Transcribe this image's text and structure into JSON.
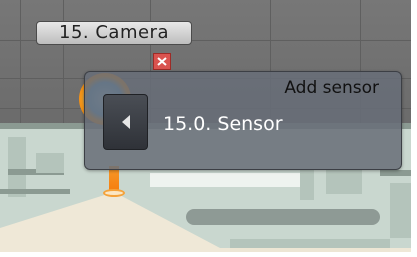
{
  "camera": {
    "label": "15. Camera"
  },
  "sensor_panel": {
    "title": "Add sensor",
    "items": [
      {
        "label": "15.0. Sensor"
      }
    ]
  },
  "icons": {
    "close": "close-icon",
    "back": "left-arrow-icon",
    "camera_marker": "camera-marker-icon"
  },
  "colors": {
    "close_button": "#d9534f",
    "camera_marker_ring": "#f58a10",
    "camera_marker_core": "#5aa6d9",
    "panel_background": "#686d78"
  }
}
